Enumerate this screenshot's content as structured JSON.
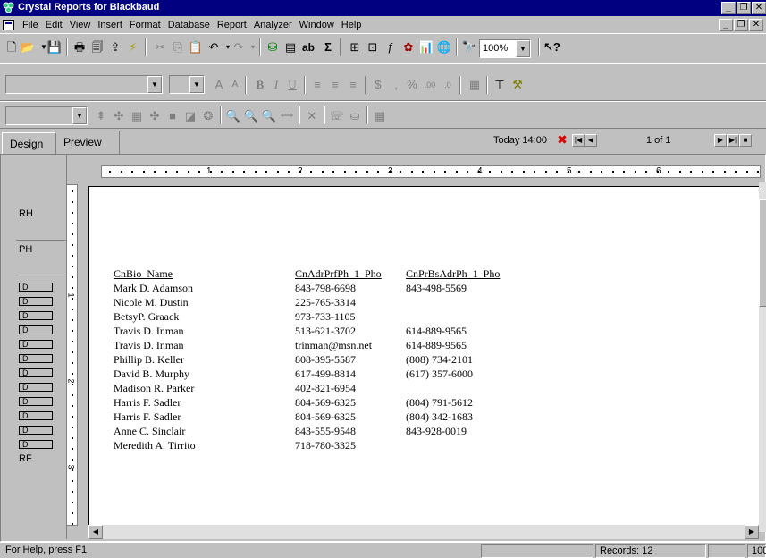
{
  "window": {
    "title": "Crystal Reports for Blackbaud"
  },
  "menubar": {
    "items": [
      "File",
      "Edit",
      "View",
      "Insert",
      "Format",
      "Database",
      "Report",
      "Analyzer",
      "Window",
      "Help"
    ]
  },
  "toolbar1": {
    "zoom_value": "100%",
    "icons": [
      "new-icon",
      "open-icon",
      "save-icon",
      "print-icon",
      "print-preview-icon",
      "export-icon",
      "refresh-icon",
      "cut-icon",
      "copy-icon",
      "paste-icon",
      "undo-icon",
      "redo-icon",
      "database-expert-icon",
      "field-icon",
      "text-object-icon",
      "sum-icon",
      "group-icon",
      "select-expert-icon",
      "formula-icon",
      "highlight-icon",
      "chart-icon",
      "map-icon",
      "find-icon",
      "help-icon"
    ]
  },
  "toolbar2": {
    "font_value": "",
    "size_value": ""
  },
  "toolbar3": {
    "style_value": ""
  },
  "tabs": [
    {
      "label": "Design"
    },
    {
      "label": "Preview"
    }
  ],
  "preview_nav": {
    "timestamp": "Today 14:00",
    "page_indicator": "1 of 1"
  },
  "ruler": {
    "inch_labels": [
      "1",
      "2",
      "3",
      "4",
      "5",
      "6"
    ]
  },
  "sections": {
    "report_header": "RH",
    "page_header": "PH",
    "detail_marker": "D",
    "report_footer": "RF",
    "vruler_labels": [
      "1",
      "2",
      "3"
    ]
  },
  "report": {
    "columns": [
      "CnBio_Name",
      "CnAdrPrfPh_1_Pho",
      "CnPrBsAdrPh_1_Pho"
    ],
    "rows": [
      [
        "Mark D. Adamson",
        "843-798-6698",
        "843-498-5569"
      ],
      [
        "Nicole M. Dustin",
        "225-765-3314",
        ""
      ],
      [
        "BetsyP. Graack",
        "973-733-1105",
        ""
      ],
      [
        "Travis D. Inman",
        "513-621-3702",
        "614-889-9565"
      ],
      [
        "Travis D. Inman",
        "trinman@msn.net",
        "614-889-9565"
      ],
      [
        "Phillip B. Keller",
        "808-395-5587",
        "(808) 734-2101"
      ],
      [
        "David B. Murphy",
        "617-499-8814",
        "(617) 357-6000"
      ],
      [
        "Madison R. Parker",
        "402-821-6954",
        ""
      ],
      [
        "Harris F. Sadler",
        "804-569-6325",
        "(804) 791-5612"
      ],
      [
        "Harris F. Sadler",
        "804-569-6325",
        "(804) 342-1683"
      ],
      [
        "Anne C. Sinclair",
        "843-555-9548",
        "843-928-0019"
      ],
      [
        "Meredith A. Tirrito",
        "718-780-3325",
        ""
      ]
    ]
  },
  "statusbar": {
    "help_text": "For Help, press F1",
    "records": "Records: 12",
    "zoom": "100"
  }
}
